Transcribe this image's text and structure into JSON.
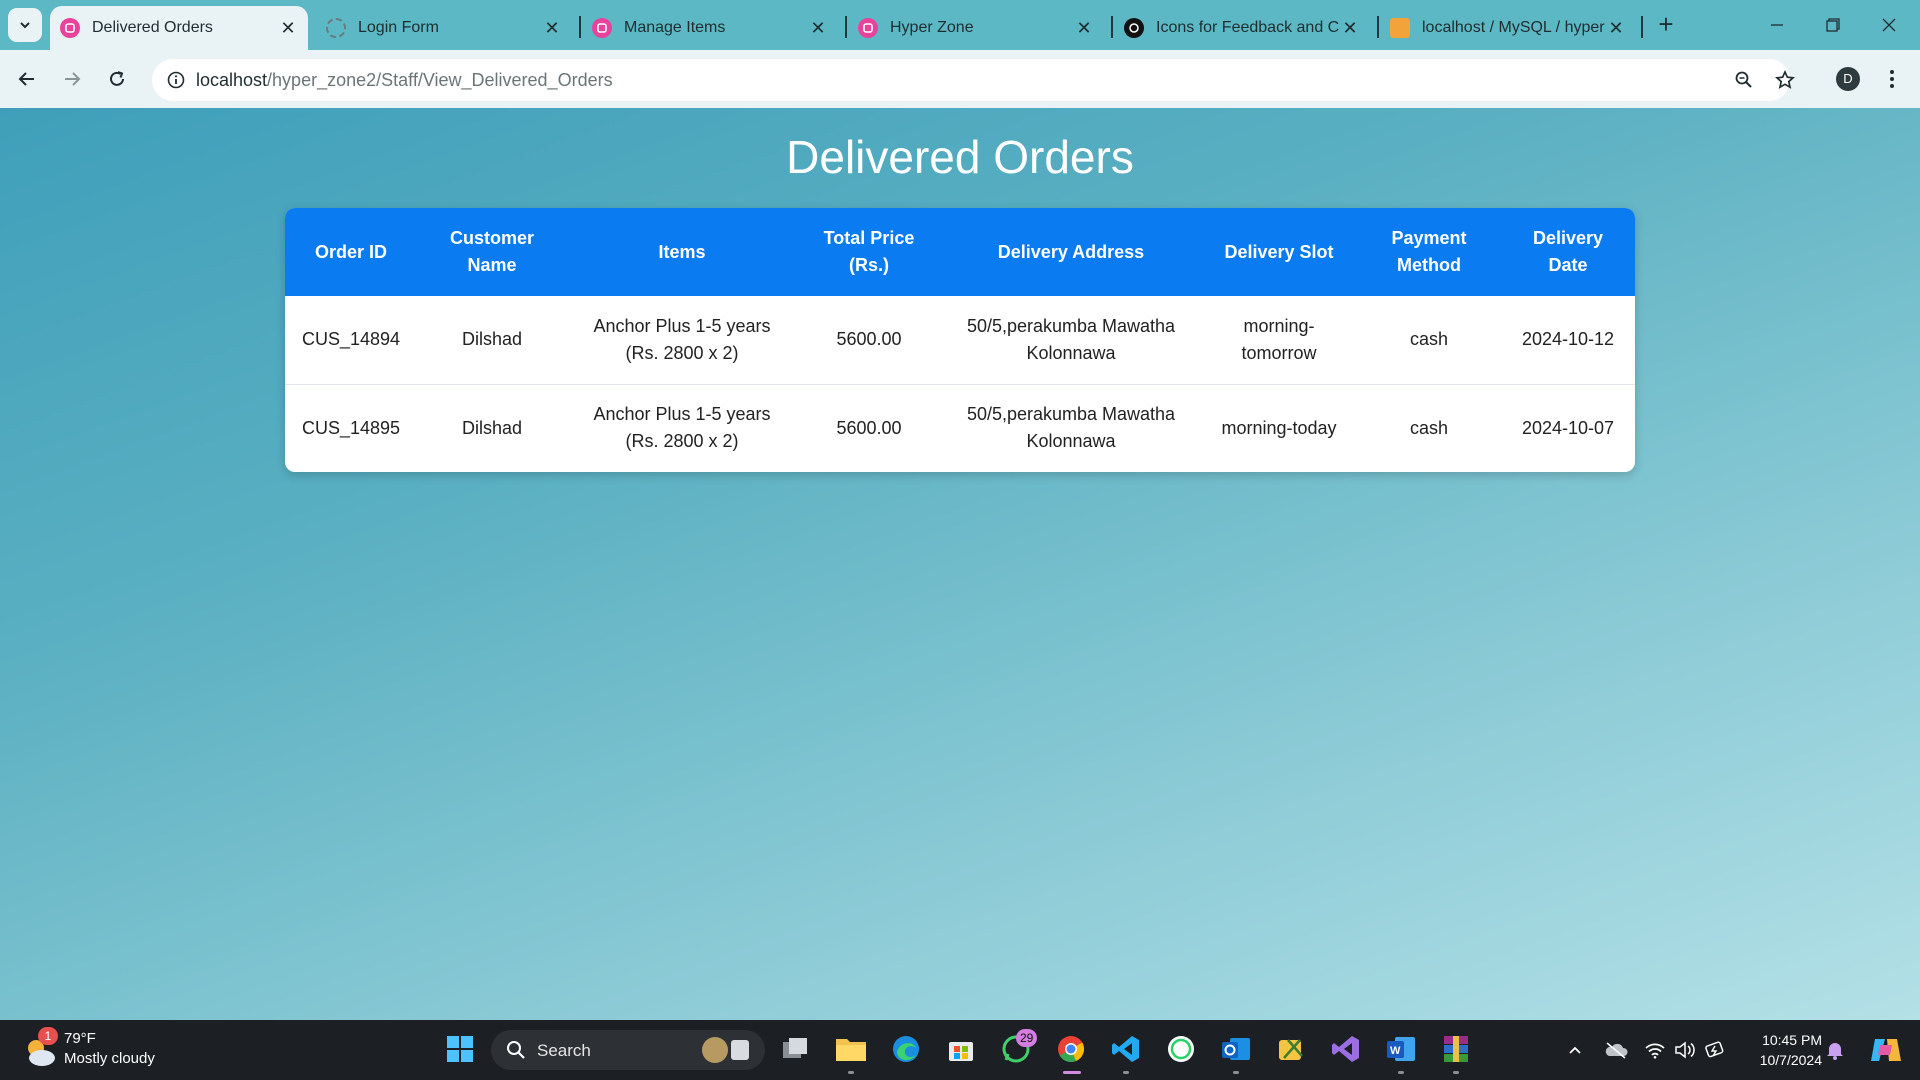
{
  "browser": {
    "tabs": [
      {
        "title": "Delivered Orders",
        "active": true,
        "favicon": "hyperzone-icon"
      },
      {
        "title": "Login Form",
        "active": false,
        "favicon": "loading-icon"
      },
      {
        "title": "Manage Items",
        "active": false,
        "favicon": "hyperzone-icon"
      },
      {
        "title": "Hyper Zone",
        "active": false,
        "favicon": "hyperzone-icon"
      },
      {
        "title": "Icons for Feedback and Co",
        "active": false,
        "favicon": "openai-icon"
      },
      {
        "title": "localhost / MySQL / hyper",
        "active": false,
        "favicon": "phpmyadmin-icon"
      }
    ],
    "url_host": "localhost",
    "url_path": "/hyper_zone2/Staff/View_Delivered_Orders",
    "profile_initial": "D"
  },
  "page": {
    "heading": "Delivered Orders",
    "table": {
      "headers": [
        "Order ID",
        "Customer Name",
        "Items",
        "Total Price (Rs.)",
        "Delivery Address",
        "Delivery Slot",
        "Payment Method",
        "Delivery Date"
      ],
      "rows": [
        [
          "CUS_14894",
          "Dilshad",
          "Anchor Plus 1-5 years (Rs. 2800 x 2)",
          "5600.00",
          "50/5,perakumba Mawatha Kolonnawa",
          "morning-tomorrow",
          "cash",
          "2024-10-12"
        ],
        [
          "CUS_14895",
          "Dilshad",
          "Anchor Plus 1-5 years (Rs. 2800 x 2)",
          "5600.00",
          "50/5,perakumba Mawatha Kolonnawa",
          "morning-today",
          "cash",
          "2024-10-07"
        ]
      ]
    }
  },
  "taskbar": {
    "weather_temp": "79°F",
    "weather_desc": "Mostly cloudy",
    "weather_badge": "1",
    "search_label": "Search",
    "whatsapp_badge": "29",
    "time": "10:45 PM",
    "date": "10/7/2024"
  },
  "colors": {
    "header_blue": "#0a7bf0",
    "tab_strip": "#5cb8c4",
    "page_gradient_start": "#3f9fba",
    "page_gradient_end": "#b4e0e7"
  }
}
